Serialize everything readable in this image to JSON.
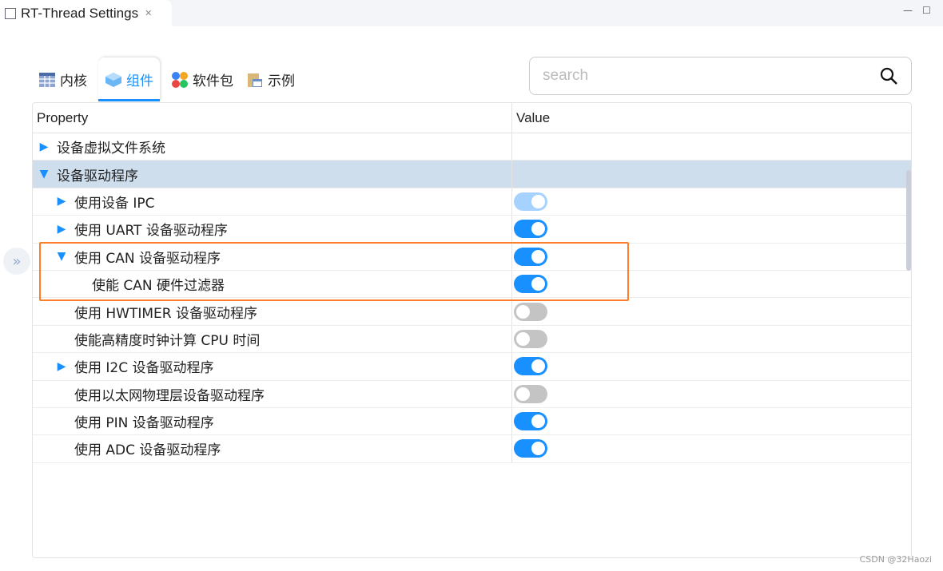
{
  "window": {
    "title": "RT-Thread Settings",
    "close": "✕",
    "minimize": "—",
    "maximize": "☐"
  },
  "tabs": [
    {
      "label": "内核",
      "icon": "table-icon"
    },
    {
      "label": "组件",
      "icon": "cube-icon",
      "active": true
    },
    {
      "label": "软件包",
      "icon": "packages-icon"
    },
    {
      "label": "示例",
      "icon": "clipboard-icon"
    }
  ],
  "search": {
    "placeholder": "search",
    "value": ""
  },
  "table": {
    "headers": [
      "Property",
      "Value"
    ],
    "rows": [
      {
        "label": "设备虚拟文件系统",
        "level": 0,
        "expander": "collapsed",
        "toggle": null
      },
      {
        "label": "设备驱动程序",
        "level": 0,
        "expander": "expanded",
        "toggle": null,
        "selected": true
      },
      {
        "label": "使用设备 IPC",
        "level": 1,
        "expander": "collapsed",
        "toggle": "on-disabled"
      },
      {
        "label": "使用 UART 设备驱动程序",
        "level": 1,
        "expander": "collapsed",
        "toggle": "on"
      },
      {
        "label": "使用 CAN 设备驱动程序",
        "level": 1,
        "expander": "expanded",
        "toggle": "on"
      },
      {
        "label": "使能 CAN 硬件过滤器",
        "level": 2,
        "expander": null,
        "toggle": "on"
      },
      {
        "label": "使用 HWTIMER 设备驱动程序",
        "level": 1,
        "expander": null,
        "toggle": "off"
      },
      {
        "label": "使能高精度时钟计算 CPU 时间",
        "level": 1,
        "expander": null,
        "toggle": "off"
      },
      {
        "label": "使用 I2C 设备驱动程序",
        "level": 1,
        "expander": "collapsed",
        "toggle": "on"
      },
      {
        "label": "使用以太网物理层设备驱动程序",
        "level": 1,
        "expander": null,
        "toggle": "off"
      },
      {
        "label": "使用 PIN 设备驱动程序",
        "level": 1,
        "expander": null,
        "toggle": "on"
      },
      {
        "label": "使用 ADC 设备驱动程序",
        "level": 1,
        "expander": null,
        "toggle": "on"
      }
    ]
  },
  "colors": {
    "accent": "#1890ff",
    "highlight": "#ff7d26",
    "selected_row": "#cfdeed"
  },
  "watermark": "CSDN @32Haozi"
}
